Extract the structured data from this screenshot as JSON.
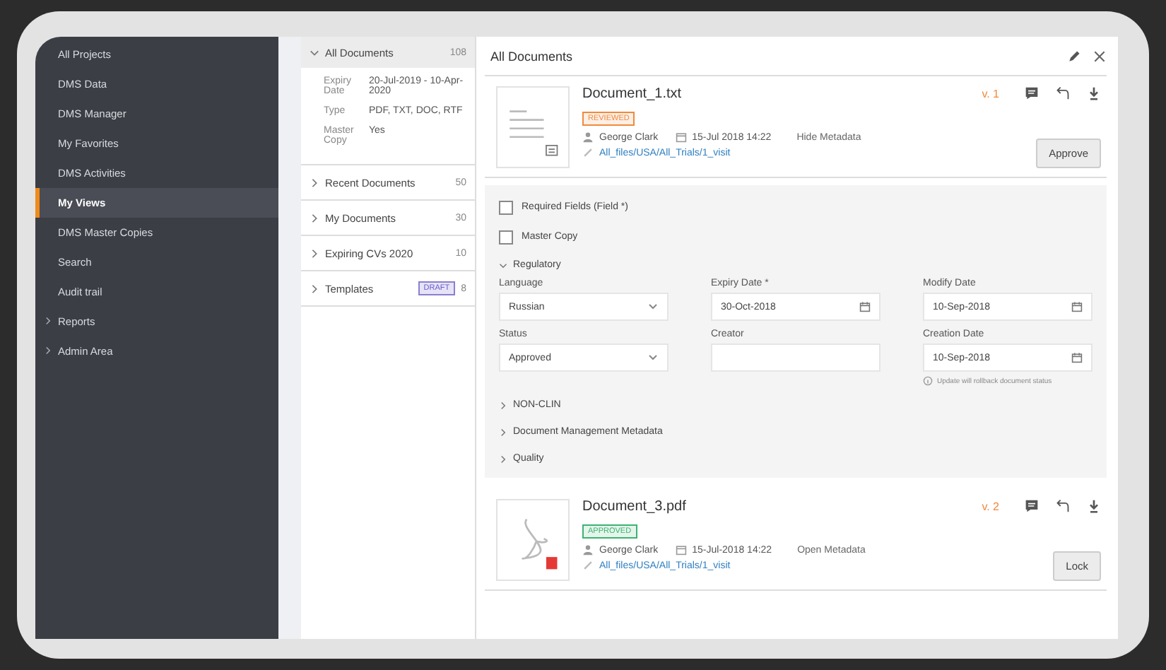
{
  "sidebar": {
    "items": [
      {
        "label": "All Projects",
        "selected": false,
        "expandable": false
      },
      {
        "label": "DMS Data",
        "selected": false,
        "expandable": false
      },
      {
        "label": "DMS Manager",
        "selected": false,
        "expandable": false
      },
      {
        "label": "My Favorites",
        "selected": false,
        "expandable": false
      },
      {
        "label": "DMS Activities",
        "selected": false,
        "expandable": false
      },
      {
        "label": "My Views",
        "selected": true,
        "expandable": false
      },
      {
        "label": "DMS Master Copies",
        "selected": false,
        "expandable": false
      },
      {
        "label": "Search",
        "selected": false,
        "expandable": false
      },
      {
        "label": "Audit trail",
        "selected": false,
        "expandable": false
      },
      {
        "label": "Reports",
        "selected": false,
        "expandable": true
      },
      {
        "label": "Admin Area",
        "selected": false,
        "expandable": true
      }
    ]
  },
  "views": [
    {
      "label": "All Documents",
      "count": "108",
      "expanded": true,
      "details": [
        {
          "label": "Expiry Date",
          "value": "20-Jul-2019 - 10-Apr-2020"
        },
        {
          "label": "Type",
          "value": "PDF, TXT, DOC, RTF"
        },
        {
          "label": "Master Copy",
          "value": "Yes"
        }
      ]
    },
    {
      "label": "Recent Documents",
      "count": "50",
      "expanded": false
    },
    {
      "label": "My Documents",
      "count": "30",
      "expanded": false
    },
    {
      "label": "Expiring CVs 2020",
      "count": "10",
      "expanded": false
    },
    {
      "label": "Templates",
      "count": "8",
      "expanded": false,
      "badge": "DRAFT"
    }
  ],
  "main": {
    "title": "All Documents",
    "documents": [
      {
        "kind": "text",
        "name": "Document_1.txt",
        "status": "REVIEWED",
        "color": "#f08a3c",
        "author": "George Clark",
        "date": "15-Jul 2018 14:22",
        "metadata_link": "Hide Metadata",
        "path": "All_files/USA/All_Trials/1_visit",
        "version": "v. 1",
        "action": "Approve",
        "metadata": {
          "checkboxes": [
            {
              "label": "Required Fields (Field *)",
              "checked": false
            },
            {
              "label": "Master Copy",
              "checked": false
            }
          ],
          "sections": [
            {
              "label": "Regulatory",
              "expanded": true,
              "fields": [
                {
                  "kind": "select",
                  "label": "Language",
                  "value": "Russian"
                },
                {
                  "kind": "date",
                  "label": "Expiry Date *",
                  "value": "30-Oct-2018"
                },
                {
                  "kind": "date",
                  "label": "Modify Date",
                  "value": "10-Sep-2018"
                },
                {
                  "kind": "select",
                  "label": "Status",
                  "value": "Approved"
                },
                {
                  "kind": "text",
                  "label": "Creator"
                },
                {
                  "kind": "date",
                  "label": "Creation Date",
                  "value": "10-Sep-2018",
                  "note": "Update will rollback document status"
                }
              ]
            },
            {
              "label": "NON-CLIN",
              "expanded": false
            },
            {
              "label": "Document Management Metadata",
              "expanded": false
            },
            {
              "label": "Quality",
              "expanded": false
            }
          ]
        }
      },
      {
        "kind": "pdf",
        "name": "Document_3.pdf",
        "status": "APPROVED",
        "color": "#3cb371",
        "author": "George Clark",
        "date": "15-Jul-2018 14:22",
        "metadata_link": "Open Metadata",
        "path": "All_files/USA/All_Trials/1_visit",
        "version": "v. 2",
        "action": "Lock"
      }
    ]
  }
}
